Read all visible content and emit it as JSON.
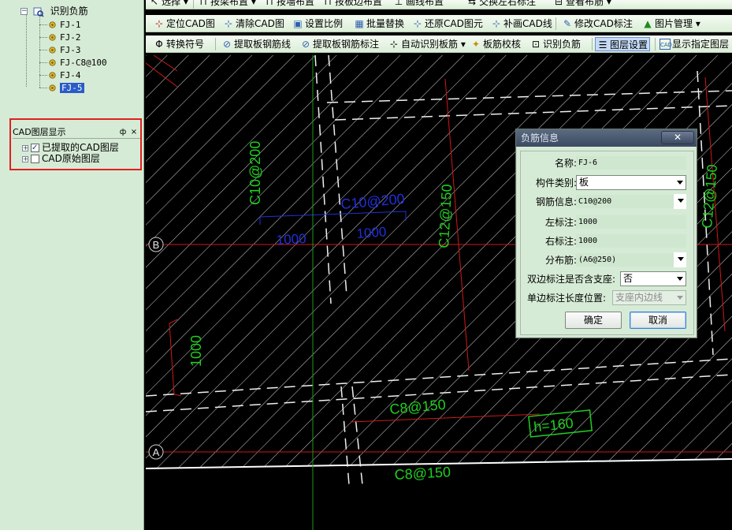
{
  "tree": {
    "root_label": "识别负筋",
    "items": [
      "FJ-1",
      "FJ-2",
      "FJ-3",
      "FJ-C8@100",
      "FJ-4",
      "FJ-5"
    ],
    "selected": "FJ-5"
  },
  "layer_panel": {
    "title": "CAD图层显示",
    "pin_glyph": "ф",
    "close_glyph": "×",
    "items": [
      {
        "label": "已提取的CAD图层",
        "checked": true
      },
      {
        "label": "CAD原始图层",
        "checked": false
      }
    ]
  },
  "toolbar0": {
    "items": [
      "选择",
      "按梁布置",
      "按墙布置",
      "按板边布置",
      "画线布置",
      "交换左右标注",
      "查看布筋"
    ]
  },
  "toolbar1": {
    "items": [
      "定位CAD图",
      "清除CAD图",
      "设置比例",
      "批量替换",
      "还原CAD图元",
      "补画CAD线",
      "修改CAD标注",
      "图片管理"
    ]
  },
  "toolbar2": {
    "items": [
      "转换符号",
      "提取板钢筋线",
      "提取板钢筋标注",
      "自动识别板筋",
      "板筋校核",
      "识别负筋",
      "图层设置",
      "显示指定图层"
    ]
  },
  "canvas": {
    "labels": {
      "axis_b": "B",
      "axis_a": "A",
      "c10_vertical": "C10@200",
      "c10_horizontal": "C10@200",
      "dim_left_1000": "1000",
      "dim_right_1000": "1000",
      "c12_mid": "C12@150",
      "c12_right": "C12@150",
      "dim_vertical_1000": "1000",
      "c8_upper": "C8@150",
      "c8_lower": "C8@150",
      "h_label": "h=160"
    },
    "colors": {
      "green": "#1fd01f",
      "blue": "#2030d8",
      "red": "#d01818",
      "hatch": "#d8d8d8"
    }
  },
  "dialog": {
    "title": "负筋信息",
    "close_glyph": "✕",
    "fields": {
      "name_label": "名称:",
      "name_value": "FJ-6",
      "type_label": "构件类别:",
      "type_value": "板",
      "rebar_label": "钢筋信息:",
      "rebar_value": "C10@200",
      "left_label": "左标注:",
      "left_value": "1000",
      "right_label": "右标注:",
      "right_value": "1000",
      "dist_label": "分布筋:",
      "dist_value": "(A6@250)",
      "double_label": "双边标注是否含支座:",
      "double_value": "否",
      "single_label": "单边标注长度位置:",
      "single_value": "支座内边线"
    },
    "ok": "确定",
    "cancel": "取消"
  }
}
